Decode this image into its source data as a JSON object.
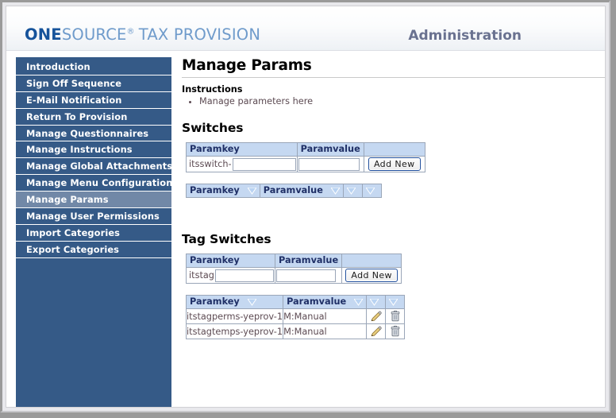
{
  "window": {
    "banner": {
      "brand_one": "ONE",
      "brand_source": "SOURCE",
      "brand_reg": "®",
      "brand_tax": "TAX PROVISION",
      "title": "Administration"
    }
  },
  "sidebar": {
    "items": [
      {
        "label": "Introduction",
        "selected": false
      },
      {
        "label": "Sign Off Sequence",
        "selected": false
      },
      {
        "label": "E-Mail Notification",
        "selected": false
      },
      {
        "label": "Return To Provision",
        "selected": false
      },
      {
        "label": "Manage Questionnaires",
        "selected": false
      },
      {
        "label": "Manage Instructions",
        "selected": false
      },
      {
        "label": "Manage Global Attachments",
        "selected": false
      },
      {
        "label": "Manage Menu Configurations",
        "selected": false
      },
      {
        "label": "Manage Params",
        "selected": true
      },
      {
        "label": "Manage User Permissions",
        "selected": false
      },
      {
        "label": "Import Categories",
        "selected": false
      },
      {
        "label": "Export Categories",
        "selected": false
      }
    ]
  },
  "main": {
    "page_title": "Manage Params",
    "instructions_heading": "Instructions",
    "instructions": [
      "Manage parameters here"
    ],
    "switches": {
      "section_title": "Switches",
      "add_form": {
        "headers": [
          "Paramkey",
          "Paramvalue",
          ""
        ],
        "key_prefix": "itsswitch-",
        "key_value": "",
        "key_placeholder": "",
        "value_value": "",
        "value_placeholder": "",
        "add_button": "Add New"
      },
      "list": {
        "headers": [
          "Paramkey",
          "Paramvalue",
          "",
          ""
        ],
        "rows": []
      }
    },
    "tag_switches": {
      "section_title": "Tag Switches",
      "add_form": {
        "headers": [
          "Paramkey",
          "Paramvalue",
          ""
        ],
        "key_prefix": "itstag",
        "key_value": "",
        "key_placeholder": "",
        "value_value": "",
        "value_placeholder": "",
        "add_button": "Add New"
      },
      "list": {
        "headers": [
          "Paramkey",
          "Paramvalue",
          "",
          ""
        ],
        "rows": [
          {
            "paramkey": "itstagperms-yeprov-1",
            "paramvalue": "M:Manual"
          },
          {
            "paramkey": "itstagtemps-yeprov-1",
            "paramvalue": "M:Manual"
          }
        ]
      }
    }
  },
  "icons": {
    "sort": "sort-descending-arrow-icon",
    "edit": "pencil-edit-icon",
    "delete": "trash-delete-icon"
  },
  "colors": {
    "sidebar_blue": "#355a87",
    "sidebar_selected": "#7188a7",
    "table_header_blue": "#c5d8f1",
    "table_header_text": "#1f2f66",
    "brand_blue": "#16539b",
    "banner_title": "#6a7290",
    "cell_text": "#5c4a52"
  }
}
